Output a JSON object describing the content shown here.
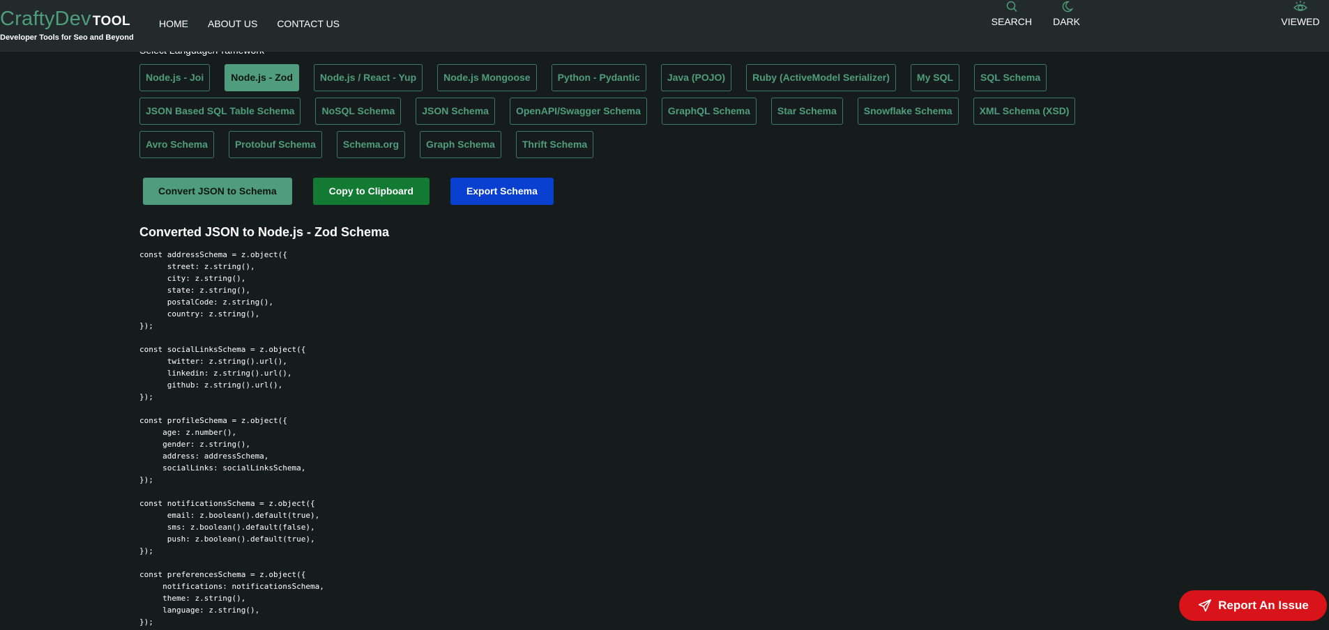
{
  "header": {
    "logo": {
      "main": "CraftyDev",
      "suffix": "TOOL",
      "tagline": "Developer Tools for Seo and Beyond"
    },
    "nav": [
      "HOME",
      "ABOUT US",
      "CONTACT US"
    ],
    "tools": {
      "search": "SEARCH",
      "dark": "DARK",
      "viewed": "VIEWED"
    }
  },
  "section_label": "Select Language/Framework",
  "languages": {
    "row1": [
      "Node.js - Joi",
      "Node.js - Zod",
      "Node.js / React - Yup",
      "Node.js Mongoose",
      "Python - Pydantic",
      "Java (POJO)",
      "Ruby (ActiveModel Serializer)",
      "My SQL",
      "SQL Schema"
    ],
    "row2": [
      "JSON Based SQL Table Schema",
      "NoSQL Schema",
      "JSON Schema",
      "OpenAPI/Swagger Schema",
      "GraphQL Schema",
      "Star Schema",
      "Snowflake Schema",
      "XML Schema (XSD)"
    ],
    "row3": [
      "Avro Schema",
      "Protobuf Schema",
      "Schema.org",
      "Graph Schema",
      "Thrift Schema"
    ],
    "selected": "Node.js - Zod"
  },
  "actions": {
    "convert": "Convert JSON to Schema",
    "copy": "Copy to Clipboard",
    "export": "Export Schema"
  },
  "result": {
    "title": "Converted JSON to Node.js - Zod Schema",
    "code": "const addressSchema = z.object({\n      street: z.string(),\n      city: z.string(),\n      state: z.string(),\n      postalCode: z.string(),\n      country: z.string(),\n});\n\nconst socialLinksSchema = z.object({\n      twitter: z.string().url(),\n      linkedin: z.string().url(),\n      github: z.string().url(),\n});\n\nconst profileSchema = z.object({\n     age: z.number(),\n     gender: z.string(),\n     address: addressSchema,\n     socialLinks: socialLinksSchema,\n});\n\nconst notificationsSchema = z.object({\n      email: z.boolean().default(true),\n      sms: z.boolean().default(false),\n      push: z.boolean().default(true),\n});\n\nconst preferencesSchema = z.object({\n     notifications: notificationsSchema,\n     theme: z.string(),\n     language: z.string(),\n});"
  },
  "report_button": "Report An Issue",
  "icons": {
    "search": "search-icon",
    "dark": "moon-icon",
    "viewed": "eye-icon",
    "report": "send-icon"
  },
  "colors": {
    "accent": "#4f9d7e",
    "background": "#161c1c",
    "header": "#222a2a",
    "copy_button": "#137a34",
    "export_button": "#0a40d0",
    "report_button": "#d8141a"
  }
}
